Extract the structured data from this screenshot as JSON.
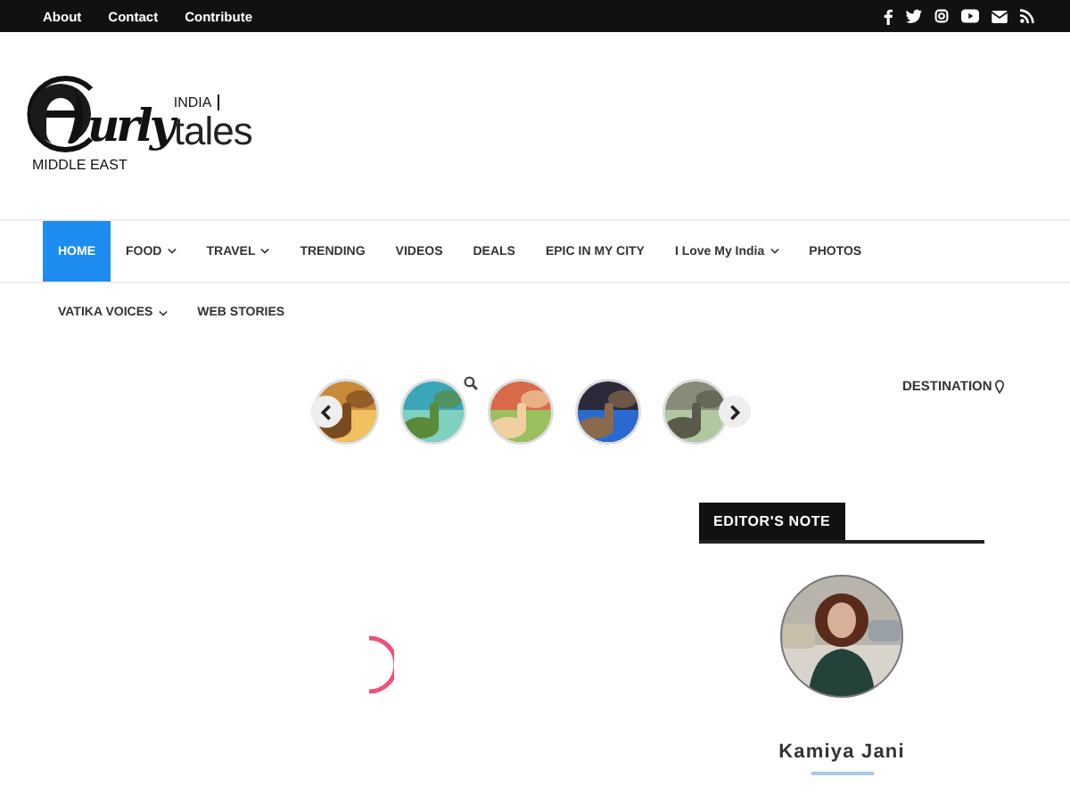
{
  "top_links": [
    {
      "label": "About"
    },
    {
      "label": "Contact"
    },
    {
      "label": "Contribute"
    }
  ],
  "logo": {
    "tagline": "INDIA",
    "script": "urly",
    "word": "tales",
    "region": "MIDDLE EAST"
  },
  "nav": {
    "row_1": [
      {
        "label": "HOME",
        "selected": true,
        "dropdown": false
      },
      {
        "label": "FOOD",
        "selected": false,
        "dropdown": true
      },
      {
        "label": "TRAVEL",
        "selected": false,
        "dropdown": true
      },
      {
        "label": "TRENDING",
        "selected": false,
        "dropdown": false
      },
      {
        "label": "VIDEOS",
        "selected": false,
        "dropdown": false
      },
      {
        "label": "DEALS",
        "selected": false,
        "dropdown": false
      },
      {
        "label": "EPIC IN MY CITY",
        "selected": false,
        "dropdown": false
      },
      {
        "label": "I Love My India",
        "selected": false,
        "dropdown": true
      },
      {
        "label": "PHOTOS",
        "selected": false,
        "dropdown": false
      }
    ],
    "row_2": [
      {
        "label": "VATIKA VOICES",
        "selected": false,
        "dropdown": true
      },
      {
        "label": "WEB STORIES",
        "selected": false,
        "dropdown": false
      }
    ]
  },
  "destination": "DESTINATION",
  "editors_note": {
    "title": "EDITOR'S NOTE",
    "name": "Kamiya Jani"
  }
}
